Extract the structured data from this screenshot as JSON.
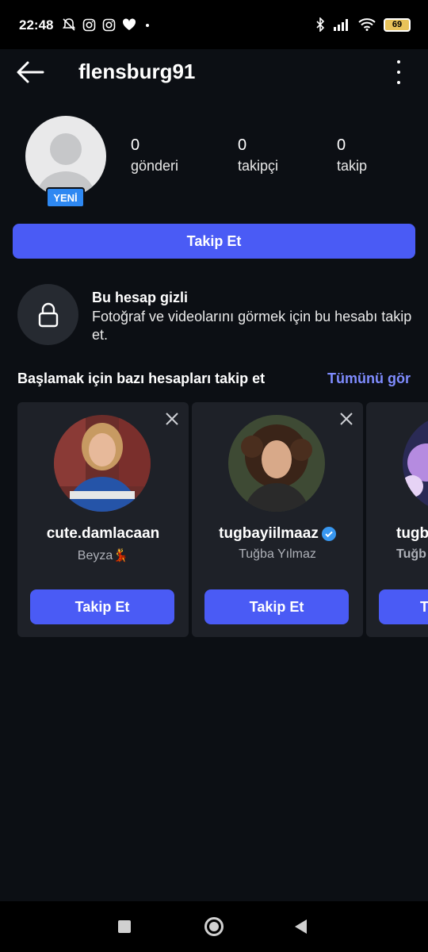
{
  "status_bar": {
    "time": "22:48",
    "left_icons": [
      "mute-bell-icon",
      "instagram-icon",
      "instagram-icon",
      "heart-icon",
      "dot-icon"
    ],
    "right_icons": [
      "bluetooth-icon",
      "signal-icon",
      "wifi-icon"
    ],
    "battery": "69"
  },
  "header": {
    "username": "flensburg91"
  },
  "profile": {
    "badge": "YENİ",
    "stats": [
      {
        "value": "0",
        "label": "gönderi"
      },
      {
        "value": "0",
        "label": "takipçi"
      },
      {
        "value": "0",
        "label": "takip"
      }
    ],
    "follow_label": "Takip Et"
  },
  "private": {
    "title": "Bu hesap gizli",
    "description": "Fotoğraf ve videolarını görmek için bu hesabı takip et."
  },
  "suggestions": {
    "heading": "Başlamak için bazı hesapları takip et",
    "see_all": "Tümünü gör",
    "cards": [
      {
        "username": "cute.damlacaan",
        "name": "Beyza💃",
        "verified": false,
        "button": "Takip Et"
      },
      {
        "username": "tugbayiilmaaz",
        "name": "Tuğba Yılmaz",
        "verified": true,
        "button": "Takip Et"
      },
      {
        "username": "tugb",
        "name": "Tuğb",
        "verified": false,
        "button": "T"
      }
    ]
  },
  "colors": {
    "accent": "#4a5bf5",
    "link": "#7f8cff",
    "badge": "#2e88f2",
    "background": "#0c0f14",
    "card": "#1e2128"
  }
}
